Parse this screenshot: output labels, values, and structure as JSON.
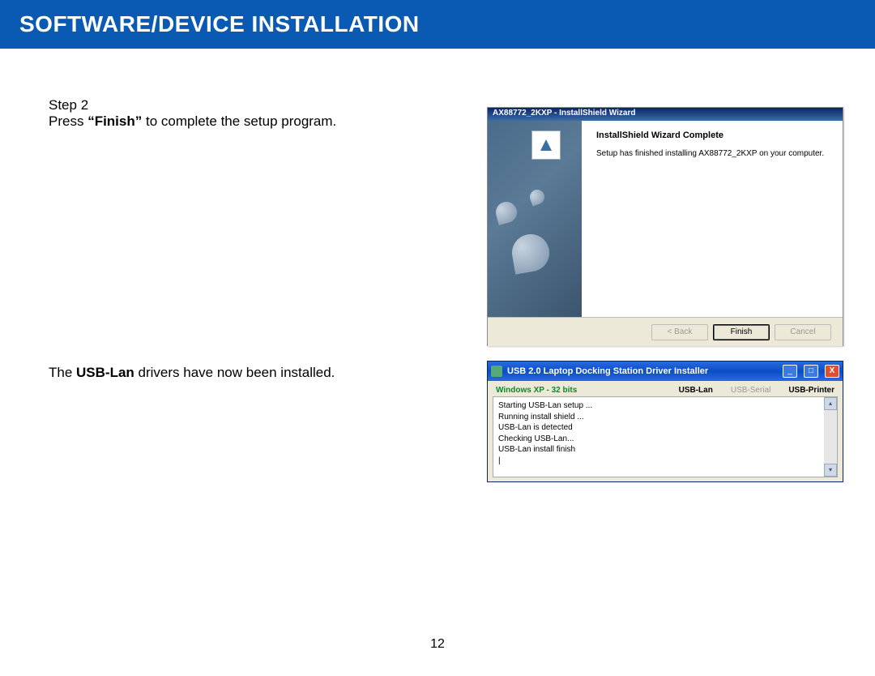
{
  "header": {
    "title": "SOFTWARE/DEVICE INSTALLATION"
  },
  "step2": {
    "label": "Step 2",
    "line_prefix": "Press ",
    "bold": "“Finish”",
    "line_suffix": " to complete the setup program."
  },
  "result": {
    "prefix": "The ",
    "bold": "USB-Lan",
    "suffix": " drivers have now been installed."
  },
  "wizard": {
    "title": "AX88772_2KXP - InstallShield Wizard",
    "heading": "InstallShield Wizard Complete",
    "text": "Setup has finished installing AX88772_2KXP on your computer.",
    "btn_back": "< Back",
    "btn_finish": "Finish",
    "btn_cancel": "Cancel"
  },
  "driver": {
    "title": "USB 2.0 Laptop Docking Station Driver Installer",
    "os": "Windows XP - 32 bits",
    "tabs": {
      "lan": "USB-Lan",
      "serial": "USB-Serial",
      "printer": "USB-Printer"
    },
    "log": [
      "Starting USB-Lan setup ...",
      "Running install shield ...",
      "USB-Lan is detected",
      "Checking USB-Lan...",
      "USB-Lan install finish"
    ]
  },
  "page_number": "12"
}
